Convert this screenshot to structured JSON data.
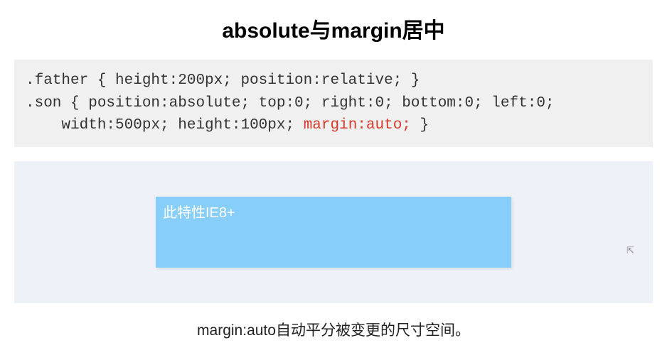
{
  "title": "absolute与margin居中",
  "code": {
    "line1": ".father { height:200px; position:relative; }",
    "line2_pre": ".son { position:absolute; top:0; right:0; bottom:0; left:0;\n    width:500px; height:100px; ",
    "line2_hl": "margin:auto;",
    "line2_post": " }"
  },
  "demo": {
    "son_text": "此特性IE8+"
  },
  "caption": "margin:auto自动平分被变更的尺寸空间。"
}
